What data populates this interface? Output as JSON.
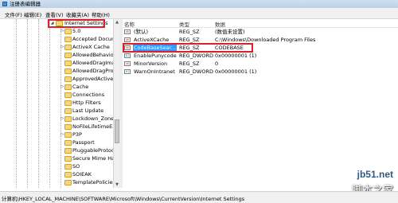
{
  "window": {
    "title": "注册表编辑器"
  },
  "menu": [
    "文件(F)",
    "编辑(E)",
    "查看(V)",
    "收藏夹(A)",
    "帮助(H)"
  ],
  "tree": {
    "selected": "Internet Settings",
    "items": [
      "5.0",
      "Accepted Docum",
      "ActiveX Cache",
      "AllowedBehavior",
      "AllowedDragImag",
      "AllowedDragProt",
      "ApprovedActiveX",
      "Cache",
      "Connections",
      "Http Filters",
      "Last Update",
      "Lockdown_Zones",
      "NoFileLifetimeExt",
      "P3P",
      "Passport",
      "PluggableProtoco",
      "Secure Mime Han",
      "SO",
      "SOIEAK",
      "TemplatePolicies"
    ]
  },
  "list": {
    "columns": {
      "name": "名称",
      "type": "类型",
      "data": "数据"
    },
    "rows": [
      {
        "icon": "string-value-icon",
        "name": "(默认)",
        "type": "REG_SZ",
        "data": "(数值未设置)"
      },
      {
        "icon": "string-value-icon",
        "name": "ActiveXCache",
        "type": "REG_SZ",
        "data": "C:\\Windows\\Downloaded Program Files"
      },
      {
        "icon": "string-value-icon",
        "name": "CodeBaseSear...",
        "type": "REG_SZ",
        "data": "CODEBASE",
        "selected": true
      },
      {
        "icon": "dword-value-icon",
        "name": "EnablePunycode",
        "type": "REG_DWORD",
        "data": "0x00000001 (1)"
      },
      {
        "icon": "string-value-icon",
        "name": "MinorVersion",
        "type": "REG_SZ",
        "data": "0"
      },
      {
        "icon": "dword-value-icon",
        "name": "WarnOnIntranet",
        "type": "REG_DWORD",
        "data": "0x00000001 (1)"
      }
    ]
  },
  "status": {
    "path": "计算机\\HKEY_LOCAL_MACHINE\\SOFTWARE\\Microsoft\\Windows\\CurrentVersion\\Internet Settings"
  },
  "watermark": {
    "site": "jb51.net",
    "brand": "脚本之家"
  },
  "colors": {
    "highlight_box": "#d8212b",
    "selection": "#3399ff"
  }
}
